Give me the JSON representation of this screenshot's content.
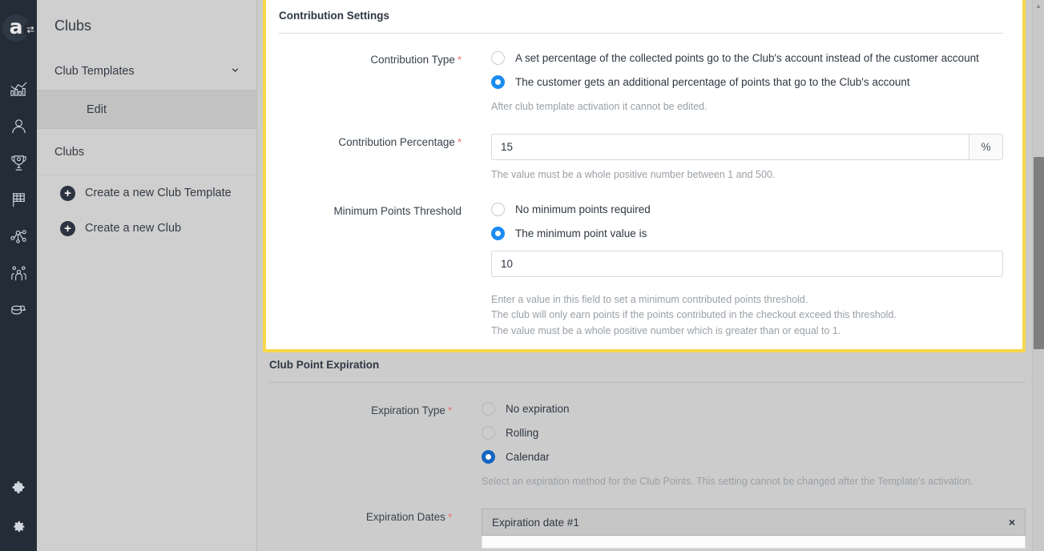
{
  "rail": {
    "logo_letter": "a",
    "badge_icon": "swap-icon",
    "icons": [
      {
        "name": "analytics-icon"
      },
      {
        "name": "customer-icon"
      },
      {
        "name": "trophy-icon"
      },
      {
        "name": "campaign-flag-icon"
      },
      {
        "name": "network-icon"
      },
      {
        "name": "audience-group-icon"
      },
      {
        "name": "database-coins-icon"
      }
    ],
    "bottom_icons": [
      {
        "name": "puzzle-icon"
      },
      {
        "name": "gear-icon"
      }
    ]
  },
  "sidebar": {
    "title": "Clubs",
    "items": [
      {
        "label": "Club Templates",
        "type": "expandable",
        "icon": "chevron-down-icon"
      },
      {
        "label": "Edit",
        "type": "sub",
        "selected": true
      },
      {
        "label": "Clubs",
        "type": "plain"
      }
    ],
    "actions": [
      {
        "label": "Create a new Club Template",
        "icon": "plus-circle-icon"
      },
      {
        "label": "Create a new Club",
        "icon": "plus-circle-icon"
      }
    ]
  },
  "contribution": {
    "section_title": "Contribution Settings",
    "type_label": "Contribution Type",
    "type_options": [
      {
        "label": "A set percentage of the collected points go to the Club's account instead of the customer account",
        "selected": false
      },
      {
        "label": "The customer gets an additional percentage of points that go to the Club's account",
        "selected": true
      }
    ],
    "type_hint": "After club template activation it cannot be edited.",
    "percentage_label": "Contribution Percentage",
    "percentage_value": "15",
    "percentage_suffix": "%",
    "percentage_hint": "The value must be a whole positive number between 1 and 500.",
    "threshold_label": "Minimum Points Threshold",
    "threshold_options": [
      {
        "label": "No minimum points required",
        "selected": false
      },
      {
        "label": "The minimum point value is",
        "selected": true
      }
    ],
    "threshold_value": "10",
    "threshold_hints": [
      "Enter a value in this field to set a minimum contributed points threshold.",
      "The club will only earn points if the points contributed in the checkout exceed this threshold.",
      "The value must be a whole positive number which is greater than or equal to 1."
    ]
  },
  "expiration": {
    "section_title": "Club Point Expiration",
    "type_label": "Expiration Type",
    "type_options": [
      {
        "label": "No expiration",
        "selected": false
      },
      {
        "label": "Rolling",
        "selected": false
      },
      {
        "label": "Calendar",
        "selected": true
      }
    ],
    "type_hint": "Select an expiration method for the Club Points. This setting cannot be changed after the Template's activation.",
    "dates_label": "Expiration Dates",
    "date_item_label": "Expiration date #1",
    "date_item_close": "×"
  },
  "required_marker": "*",
  "colors": {
    "highlight_border": "#f7d84b",
    "radio_accent": "#1a8cf0",
    "radio_accent_dark": "#1565c0",
    "rail_bg": "#242c38",
    "sidebar_bg": "#cfcfcf",
    "required_star": "#f06a6a"
  },
  "scrollbar": {
    "up_arrow": "▲"
  }
}
